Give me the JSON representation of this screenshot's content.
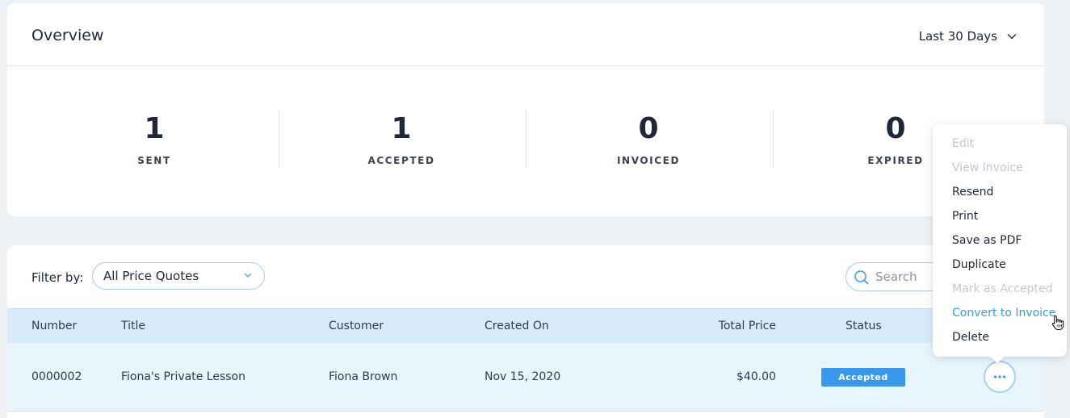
{
  "overview": {
    "title": "Overview",
    "range_label": "Last 30 Days",
    "stats": [
      {
        "value": "1",
        "label": "SENT"
      },
      {
        "value": "1",
        "label": "ACCEPTED"
      },
      {
        "value": "0",
        "label": "INVOICED"
      },
      {
        "value": "0",
        "label": "EXPIRED"
      }
    ]
  },
  "filters": {
    "filter_label": "Filter by:",
    "selected": "All Price Quotes",
    "search_placeholder": "Search"
  },
  "table": {
    "columns": [
      "Number",
      "Title",
      "Customer",
      "Created On",
      "Total Price",
      "Status"
    ],
    "rows": [
      {
        "number": "0000002",
        "title": "Fiona's Private Lesson",
        "customer": "Fiona Brown",
        "created_on": "Nov 15, 2020",
        "total_price": "$40.00",
        "status": "Accepted"
      }
    ]
  },
  "menu": {
    "items": [
      {
        "label": "Edit",
        "state": "disabled"
      },
      {
        "label": "View Invoice",
        "state": "disabled"
      },
      {
        "label": "Resend",
        "state": "enabled"
      },
      {
        "label": "Print",
        "state": "enabled"
      },
      {
        "label": "Save as PDF",
        "state": "enabled"
      },
      {
        "label": "Duplicate",
        "state": "enabled"
      },
      {
        "label": "Mark as Accepted",
        "state": "disabled"
      },
      {
        "label": "Convert to Invoice",
        "state": "hovered"
      },
      {
        "label": "Delete",
        "state": "enabled"
      }
    ]
  },
  "colors": {
    "accent": "#3899ec",
    "header_bg": "#d8ebf9",
    "row_bg": "#e8f5fd",
    "page_bg": "#eef1f4"
  },
  "icons": [
    "chevron-down-icon",
    "search-icon",
    "more-dots-icon",
    "hand-cursor-icon"
  ]
}
